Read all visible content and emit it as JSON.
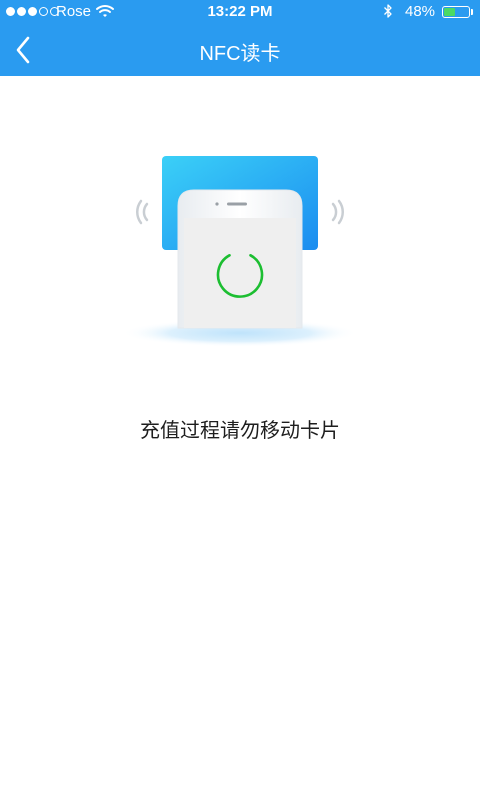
{
  "status_bar": {
    "carrier": "Rose",
    "time": "13:22 PM",
    "battery_percent_text": "48%",
    "battery_level": 0.48,
    "signal_bars_filled": 3,
    "signal_bars_total": 5,
    "icons": [
      "signal-dots",
      "wifi-icon",
      "bluetooth-icon",
      "battery-icon"
    ]
  },
  "nav": {
    "title": "NFC读卡",
    "back_icon": "chevron-left-icon"
  },
  "main": {
    "illustration": "phone-nfc-reading-card",
    "message": "充值过程请勿移动卡片"
  },
  "colors": {
    "header_bg": "#2a9bf0",
    "card_gradient_start": "#39c8f6",
    "card_gradient_end": "#1d8ff0",
    "progress_ring": "#1cbe31",
    "battery_fill": "#4cd964",
    "message_text": "#1e1e1e"
  }
}
